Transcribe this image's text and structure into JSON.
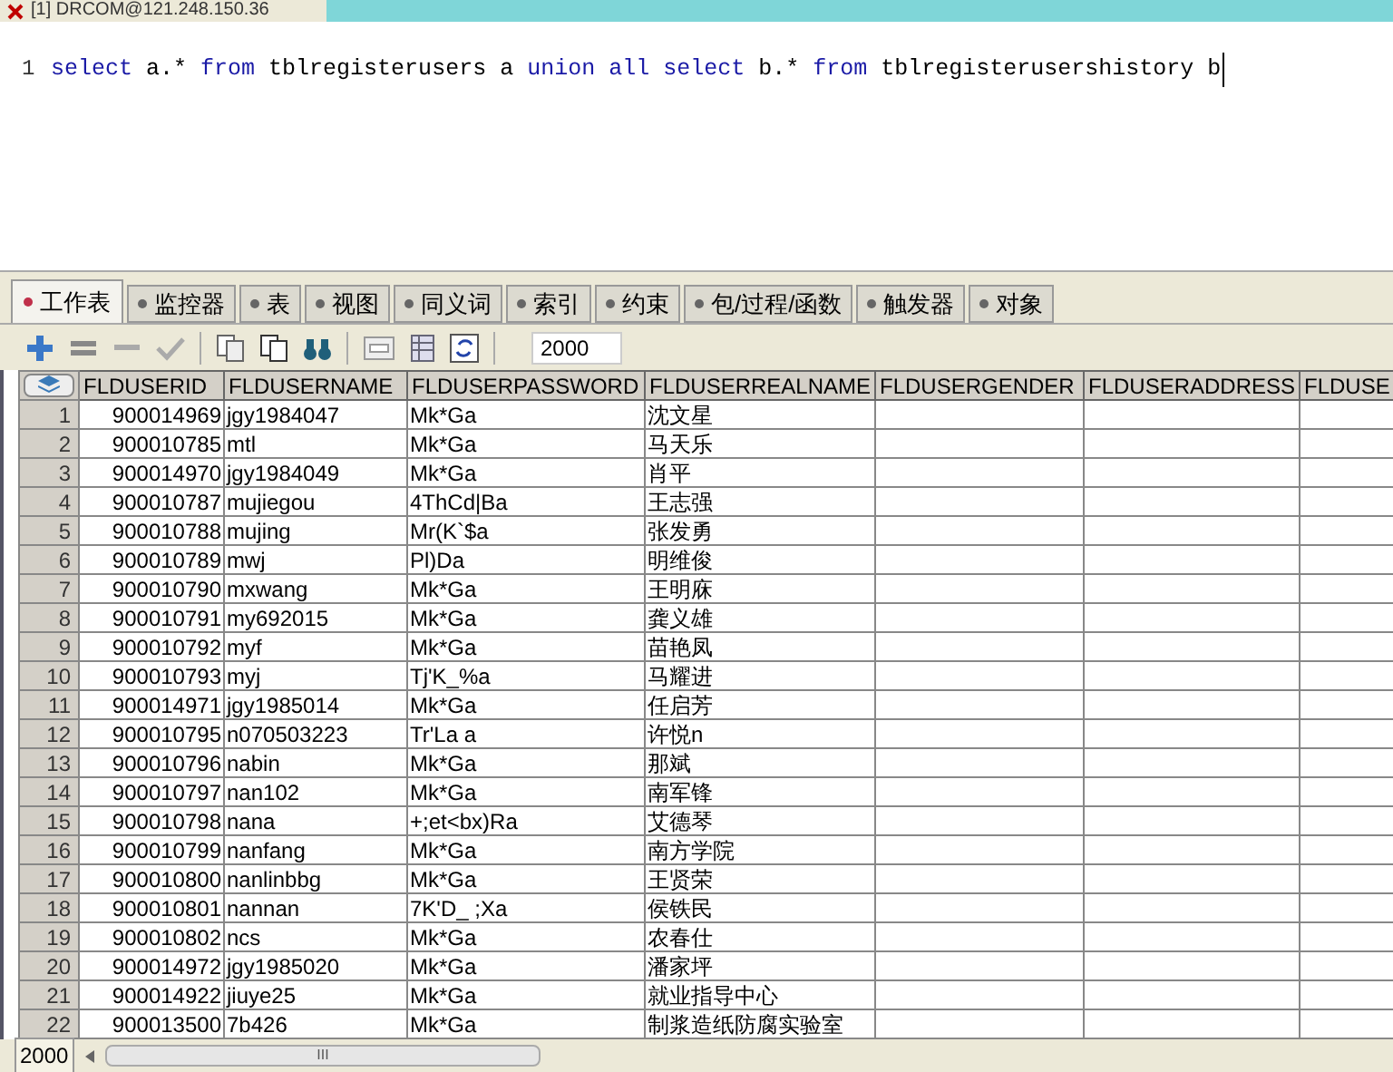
{
  "window": {
    "title": "[1] DRCOM@121.248.150.36"
  },
  "editor": {
    "line_number": "1",
    "tokens": [
      {
        "text": "select",
        "kind": "keyword"
      },
      {
        "text": " a.* ",
        "kind": "plain"
      },
      {
        "text": "from",
        "kind": "keyword"
      },
      {
        "text": " tblregisterusers a ",
        "kind": "plain"
      },
      {
        "text": "union all select",
        "kind": "keyword"
      },
      {
        "text": " b.* ",
        "kind": "plain"
      },
      {
        "text": "from",
        "kind": "keyword"
      },
      {
        "text": " tblregisterusershistory b",
        "kind": "plain"
      }
    ]
  },
  "tabs": [
    {
      "label": "工作表",
      "selected": true
    },
    {
      "label": "监控器",
      "selected": false
    },
    {
      "label": "表",
      "selected": false
    },
    {
      "label": "视图",
      "selected": false
    },
    {
      "label": "同义词",
      "selected": false
    },
    {
      "label": "索引",
      "selected": false
    },
    {
      "label": "约束",
      "selected": false
    },
    {
      "label": "包/过程/函数",
      "selected": false
    },
    {
      "label": "触发器",
      "selected": false
    },
    {
      "label": "对象",
      "selected": false
    }
  ],
  "toolbar": {
    "row_limit": "2000"
  },
  "table": {
    "columns": [
      "",
      "FLDUSERID",
      "FLDUSERNAME",
      "FLDUSERPASSWORD",
      "FLDUSERREALNAME",
      "FLDUSERGENDER",
      "FLDUSERADDRESS",
      "FLDUSE"
    ],
    "rows": [
      [
        "1",
        "900014969",
        "jgy1984047",
        "Mk*Ga",
        "沈文星"
      ],
      [
        "2",
        "900010785",
        "mtl",
        "Mk*Ga",
        "马天乐"
      ],
      [
        "3",
        "900014970",
        "jgy1984049",
        "Mk*Ga",
        "肖平"
      ],
      [
        "4",
        "900010787",
        "mujiegou",
        "4ThCd|Ba",
        "王志强"
      ],
      [
        "5",
        "900010788",
        "mujing",
        "Mr(K`$a",
        "张发勇"
      ],
      [
        "6",
        "900010789",
        "mwj",
        "Pl)Da",
        "明维俊"
      ],
      [
        "7",
        "900010790",
        "mxwang",
        "Mk*Ga",
        "王明庥"
      ],
      [
        "8",
        "900010791",
        "my692015",
        "Mk*Ga",
        "龚义雄"
      ],
      [
        "9",
        "900010792",
        "myf",
        "Mk*Ga",
        "苗艳凤"
      ],
      [
        "10",
        "900010793",
        "myj",
        "Tj'K_%a",
        "马耀进"
      ],
      [
        "11",
        "900014971",
        "jgy1985014",
        "Mk*Ga",
        "任启芳"
      ],
      [
        "12",
        "900010795",
        "n070503223",
        "Tr'La a",
        "许悦n"
      ],
      [
        "13",
        "900010796",
        "nabin",
        "Mk*Ga",
        "那斌"
      ],
      [
        "14",
        "900010797",
        "nan102",
        "Mk*Ga",
        "南军锋"
      ],
      [
        "15",
        "900010798",
        "nana",
        "+;et<bx)Ra",
        "艾德琴"
      ],
      [
        "16",
        "900010799",
        "nanfang",
        "Mk*Ga",
        "南方学院"
      ],
      [
        "17",
        "900010800",
        "nanlinbbg",
        "Mk*Ga",
        "王贤荣"
      ],
      [
        "18",
        "900010801",
        "nannan",
        "7K'D_ ;Xa",
        "侯铁民"
      ],
      [
        "19",
        "900010802",
        "ncs",
        "Mk*Ga",
        "农春仕"
      ],
      [
        "20",
        "900014972",
        "jgy1985020",
        "Mk*Ga",
        "潘家坪"
      ],
      [
        "21",
        "900014922",
        "jiuye25",
        "Mk*Ga",
        "就业指导中心"
      ],
      [
        "22",
        "900013500",
        "7b426",
        "Mk*Ga",
        "制浆造纸防腐实验室"
      ]
    ]
  },
  "status_bar": {
    "row_count": "2000",
    "scroll_grip": "III"
  }
}
